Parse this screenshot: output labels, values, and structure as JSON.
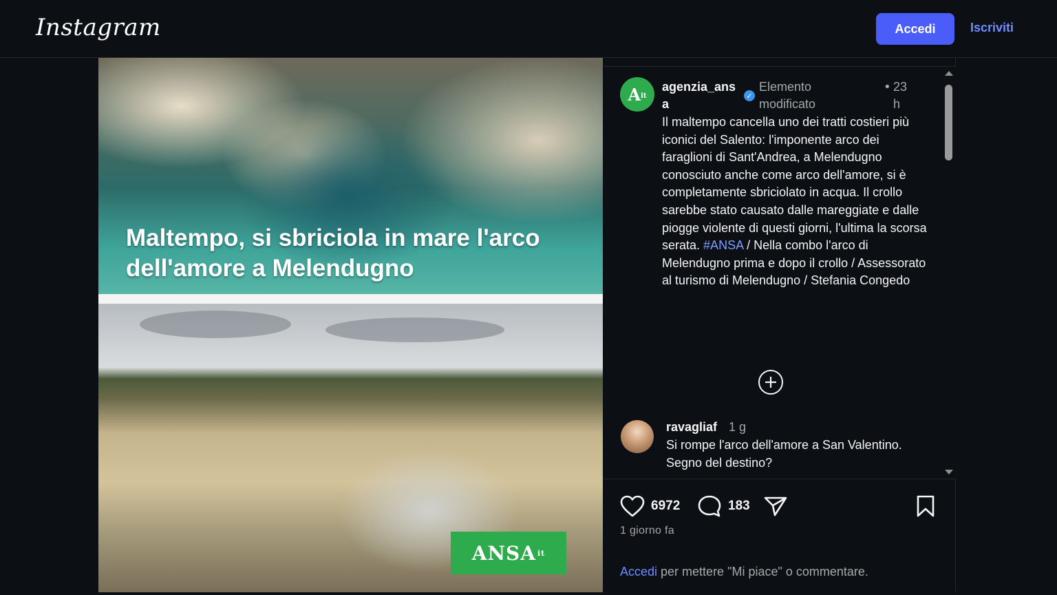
{
  "header": {
    "logo": "Instagram",
    "login_button": "Accedi",
    "signup_link": "Iscriviti"
  },
  "post": {
    "image": {
      "headline": "Maltempo, si sbriciola in mare l'arco dell'amore a Melendugno",
      "badge": "ANSA",
      "badge_suffix": "it"
    },
    "author": {
      "avatar_text": "A",
      "avatar_suffix": "it",
      "username": "agenzia_ansa",
      "edited_label": "Elemento modificato",
      "separator": "•",
      "time_ago": "23 h"
    },
    "caption": {
      "text": "Il maltempo cancella uno dei tratti costieri più iconici del Salento: l'imponente arco dei faraglioni di Sant'Andrea, a Melendugno conosciuto anche come arco dell'amore, si è completamente sbriciolato in acqua. Il crollo sarebbe stato causato dalle mareggiate e dalle piogge violente di questi giorni, l'ultima la scorsa serata.",
      "hashtag": "#ANSA",
      "text_after": " / Nella combo l'arco di Melendugno prima e dopo il crollo / Assessorato al turismo di Melendugno / Stefania Congedo"
    },
    "more_comments_icon": "plus-circle-icon",
    "comments": [
      {
        "username": "ravagliaf",
        "time": "1 g",
        "text": "Si rompe l'arco dell'amore a San Valentino. Segno del destino?"
      }
    ],
    "actions": {
      "likes": "6972",
      "comments": "183",
      "posted": "1 giorno fa",
      "login_link": "Accedi",
      "login_prompt": " per mettere \"Mi piace\" o commentare."
    }
  },
  "colors": {
    "accent": "#4a5df9",
    "link": "#6f8cff",
    "ansa_green": "#2eab4d",
    "background": "#0c0f14"
  }
}
